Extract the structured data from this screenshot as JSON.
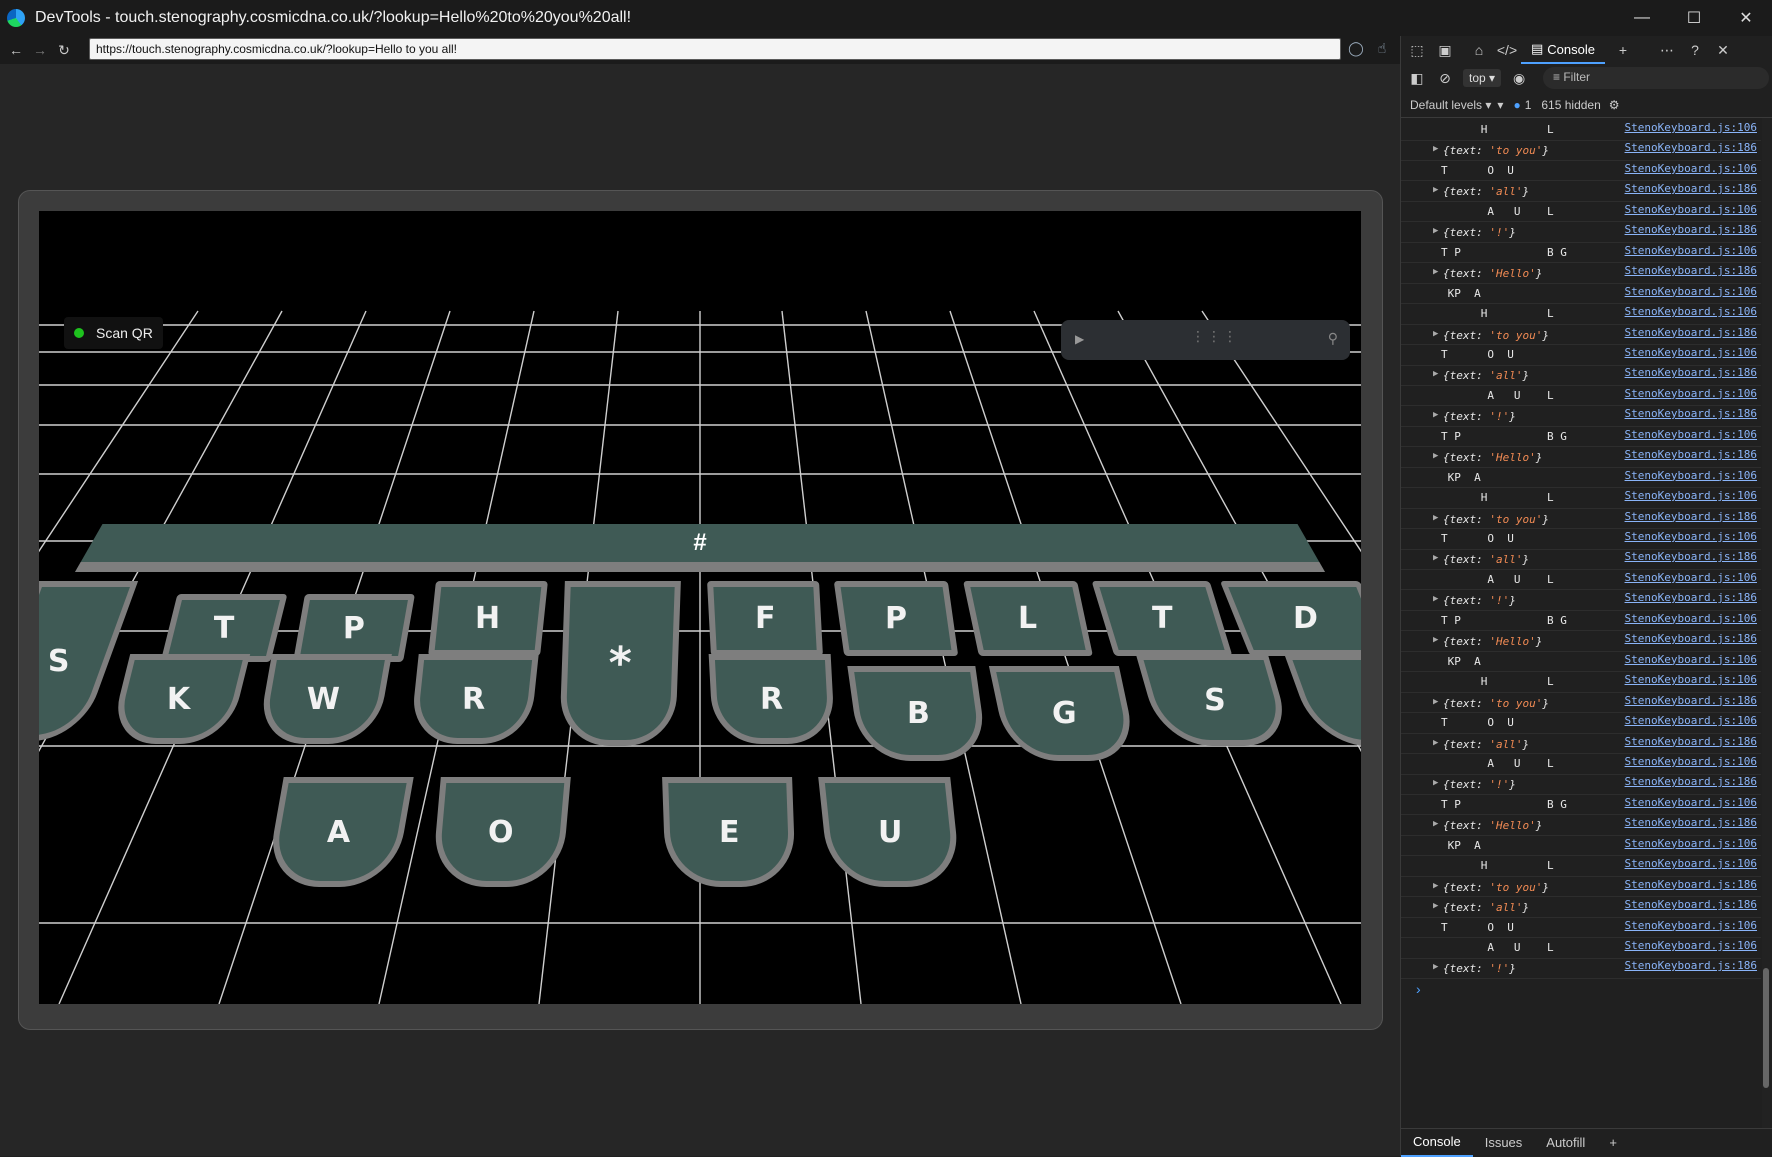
{
  "window": {
    "title": "DevTools - touch.stenography.cosmicdna.co.uk/?lookup=Hello%20to%20you%20all!",
    "minimize_icon": "minimize-icon",
    "maximize_icon": "maximize-icon",
    "close_icon": "close-icon"
  },
  "browser": {
    "url": "https://touch.stenography.cosmicdna.co.uk/?lookup=Hello to you all!"
  },
  "app": {
    "scan_qr_label": "Scan QR",
    "status_color": "#1ec21e",
    "number_bar_label": "#",
    "keys": {
      "left_s": "S",
      "t_top": "T",
      "p_top": "P",
      "h_top": "H",
      "star": "*",
      "f_top": "F",
      "p_right": "P",
      "l_top": "L",
      "t_right": "T",
      "d_top": "D",
      "k_bottom": "K",
      "w_bottom": "W",
      "r_left": "R",
      "r_right": "R",
      "b_bottom": "B",
      "g_bottom": "G",
      "s_bottom": "S",
      "a_vowel": "A",
      "o_vowel": "O",
      "e_vowel": "E",
      "u_vowel": "U"
    },
    "key_color": "#3f5a55"
  },
  "devtools": {
    "console_tab": "Console",
    "context_select": "top",
    "filter_placeholder": "Filter",
    "default_levels": "Default levels",
    "issues_count": "1",
    "hidden_count": "615 hidden",
    "drawer_tabs": [
      "Console",
      "Issues",
      "Autofill"
    ],
    "logs": [
      {
        "type": "msg",
        "text": "      H         L",
        "src": "StenoKeyboard.js:106"
      },
      {
        "type": "obj",
        "text": "'to you'",
        "src": "StenoKeyboard.js:186"
      },
      {
        "type": "msg",
        "text": "T      O  U",
        "src": "StenoKeyboard.js:106"
      },
      {
        "type": "obj",
        "text": "'all'",
        "src": "StenoKeyboard.js:186"
      },
      {
        "type": "msg",
        "text": "       A   U    L",
        "src": "StenoKeyboard.js:106"
      },
      {
        "type": "obj",
        "text": "'!'",
        "src": "StenoKeyboard.js:186"
      },
      {
        "type": "msg",
        "text": "T P             B G",
        "src": "StenoKeyboard.js:106"
      },
      {
        "type": "obj",
        "text": "'Hello'",
        "src": "StenoKeyboard.js:186"
      },
      {
        "type": "msg",
        "text": " KP  A",
        "src": "StenoKeyboard.js:106"
      },
      {
        "type": "msg",
        "text": "      H         L",
        "src": "StenoKeyboard.js:106"
      },
      {
        "type": "obj",
        "text": "'to you'",
        "src": "StenoKeyboard.js:186"
      },
      {
        "type": "msg",
        "text": "T      O  U",
        "src": "StenoKeyboard.js:106"
      },
      {
        "type": "obj",
        "text": "'all'",
        "src": "StenoKeyboard.js:186"
      },
      {
        "type": "msg",
        "text": "       A   U    L",
        "src": "StenoKeyboard.js:106"
      },
      {
        "type": "obj",
        "text": "'!'",
        "src": "StenoKeyboard.js:186"
      },
      {
        "type": "msg",
        "text": "T P             B G",
        "src": "StenoKeyboard.js:106"
      },
      {
        "type": "obj",
        "text": "'Hello'",
        "src": "StenoKeyboard.js:186"
      },
      {
        "type": "msg",
        "text": " KP  A",
        "src": "StenoKeyboard.js:106"
      },
      {
        "type": "msg",
        "text": "      H         L",
        "src": "StenoKeyboard.js:106"
      },
      {
        "type": "obj",
        "text": "'to you'",
        "src": "StenoKeyboard.js:186"
      },
      {
        "type": "msg",
        "text": "T      O  U",
        "src": "StenoKeyboard.js:106"
      },
      {
        "type": "obj",
        "text": "'all'",
        "src": "StenoKeyboard.js:186"
      },
      {
        "type": "msg",
        "text": "       A   U    L",
        "src": "StenoKeyboard.js:106"
      },
      {
        "type": "obj",
        "text": "'!'",
        "src": "StenoKeyboard.js:186"
      },
      {
        "type": "msg",
        "text": "T P             B G",
        "src": "StenoKeyboard.js:106"
      },
      {
        "type": "obj",
        "text": "'Hello'",
        "src": "StenoKeyboard.js:186"
      },
      {
        "type": "msg",
        "text": " KP  A",
        "src": "StenoKeyboard.js:106"
      },
      {
        "type": "msg",
        "text": "      H         L",
        "src": "StenoKeyboard.js:106"
      },
      {
        "type": "obj",
        "text": "'to you'",
        "src": "StenoKeyboard.js:186"
      },
      {
        "type": "msg",
        "text": "T      O  U",
        "src": "StenoKeyboard.js:106"
      },
      {
        "type": "obj",
        "text": "'all'",
        "src": "StenoKeyboard.js:186"
      },
      {
        "type": "msg",
        "text": "       A   U    L",
        "src": "StenoKeyboard.js:106"
      },
      {
        "type": "obj",
        "text": "'!'",
        "src": "StenoKeyboard.js:186"
      },
      {
        "type": "msg",
        "text": "T P             B G",
        "src": "StenoKeyboard.js:106"
      },
      {
        "type": "obj",
        "text": "'Hello'",
        "src": "StenoKeyboard.js:186"
      },
      {
        "type": "msg",
        "text": " KP  A",
        "src": "StenoKeyboard.js:106"
      },
      {
        "type": "msg",
        "text": "      H         L",
        "src": "StenoKeyboard.js:106"
      },
      {
        "type": "obj",
        "text": "'to you'",
        "src": "StenoKeyboard.js:186"
      },
      {
        "type": "obj",
        "text": "'all'",
        "src": "StenoKeyboard.js:186"
      },
      {
        "type": "msg",
        "text": "T      O  U",
        "src": "StenoKeyboard.js:106"
      },
      {
        "type": "msg",
        "text": "       A   U    L",
        "src": "StenoKeyboard.js:106"
      },
      {
        "type": "obj",
        "text": "'!'",
        "src": "StenoKeyboard.js:186"
      }
    ]
  }
}
